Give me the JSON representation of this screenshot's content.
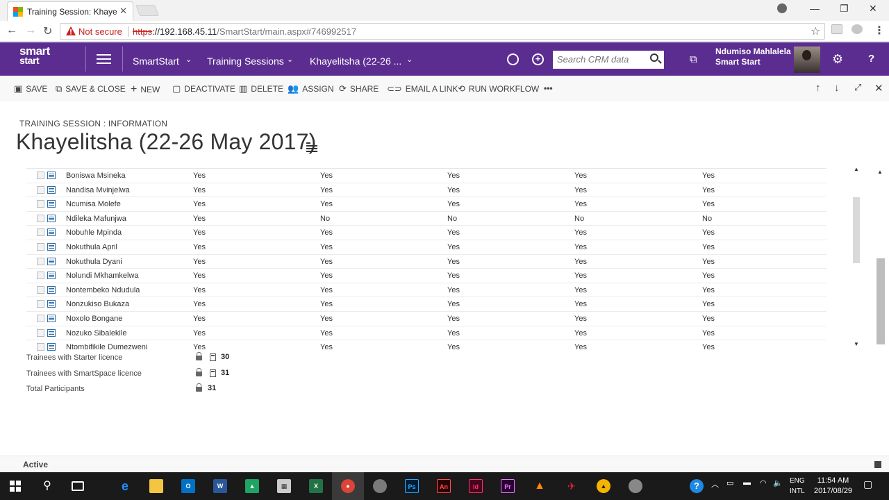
{
  "browser": {
    "tab_title": "Training Session: Khayelit",
    "not_secure_label": "Not secure",
    "url_scheme": "https",
    "url_host": "://192.168.45.11",
    "url_path": "/SmartStart/main.aspx#746992517"
  },
  "nav": {
    "logo_line1": "smart",
    "logo_line2": "start",
    "breadcrumb": [
      "SmartStart",
      "Training Sessions",
      "Khayelitsha (22-26 ..."
    ],
    "search_placeholder": "Search CRM data",
    "user_name": "Ndumiso Mahlalela",
    "user_org": "Smart Start",
    "help": "?"
  },
  "commands": {
    "save": "SAVE",
    "save_close": "SAVE & CLOSE",
    "new": "NEW",
    "deactivate": "DEACTIVATE",
    "delete": "DELETE",
    "assign": "ASSIGN",
    "share": "SHARE",
    "email_link": "EMAIL A LINK",
    "run_workflow": "RUN WORKFLOW",
    "more": "•••"
  },
  "form": {
    "entity_label": "TRAINING SESSION : INFORMATION",
    "record_title": "Khayelitsha (22-26 May 2017)"
  },
  "grid": {
    "rows": [
      {
        "name": "Boniswa Msineka",
        "values": [
          "Yes",
          "Yes",
          "Yes",
          "Yes",
          "Yes"
        ]
      },
      {
        "name": "Nandisa Mvinjelwa",
        "values": [
          "Yes",
          "Yes",
          "Yes",
          "Yes",
          "Yes"
        ]
      },
      {
        "name": "Ncumisa  Molefe",
        "values": [
          "Yes",
          "Yes",
          "Yes",
          "Yes",
          "Yes"
        ]
      },
      {
        "name": "Ndileka Mafunjwa",
        "values": [
          "Yes",
          "No",
          "No",
          "No",
          "No"
        ]
      },
      {
        "name": "Nobuhle Mpinda",
        "values": [
          "Yes",
          "Yes",
          "Yes",
          "Yes",
          "Yes"
        ]
      },
      {
        "name": "Nokuthula April",
        "values": [
          "Yes",
          "Yes",
          "Yes",
          "Yes",
          "Yes"
        ]
      },
      {
        "name": "Nokuthula Dyani",
        "values": [
          "Yes",
          "Yes",
          "Yes",
          "Yes",
          "Yes"
        ]
      },
      {
        "name": "Nolundi Mkhamkelwa",
        "values": [
          "Yes",
          "Yes",
          "Yes",
          "Yes",
          "Yes"
        ]
      },
      {
        "name": "Nontembeko Ndudula",
        "values": [
          "Yes",
          "Yes",
          "Yes",
          "Yes",
          "Yes"
        ]
      },
      {
        "name": "Nonzukiso Bukaza",
        "values": [
          "Yes",
          "Yes",
          "Yes",
          "Yes",
          "Yes"
        ]
      },
      {
        "name": "Noxolo Bongane",
        "values": [
          "Yes",
          "Yes",
          "Yes",
          "Yes",
          "Yes"
        ]
      },
      {
        "name": "Nozuko Sibalekile",
        "values": [
          "Yes",
          "Yes",
          "Yes",
          "Yes",
          "Yes"
        ]
      },
      {
        "name": "Ntombifikile Dumezweni",
        "values": [
          "Yes",
          "Yes",
          "Yes",
          "Yes",
          "Yes"
        ]
      }
    ]
  },
  "summary": {
    "starter_label": "Trainees with Starter licence",
    "starter_value": "30",
    "smartspace_label": "Trainees with SmartSpace licence",
    "smartspace_value": "31",
    "total_label": "Total Participants",
    "total_value": "31"
  },
  "status": {
    "state": "Active"
  },
  "taskbar": {
    "lang_line1": "ENG",
    "lang_line2": "INTL",
    "time": "11:54 AM",
    "date": "2017/08/29"
  },
  "colors": {
    "nav_purple": "#5c2d91",
    "not_secure_red": "#c5221f"
  }
}
